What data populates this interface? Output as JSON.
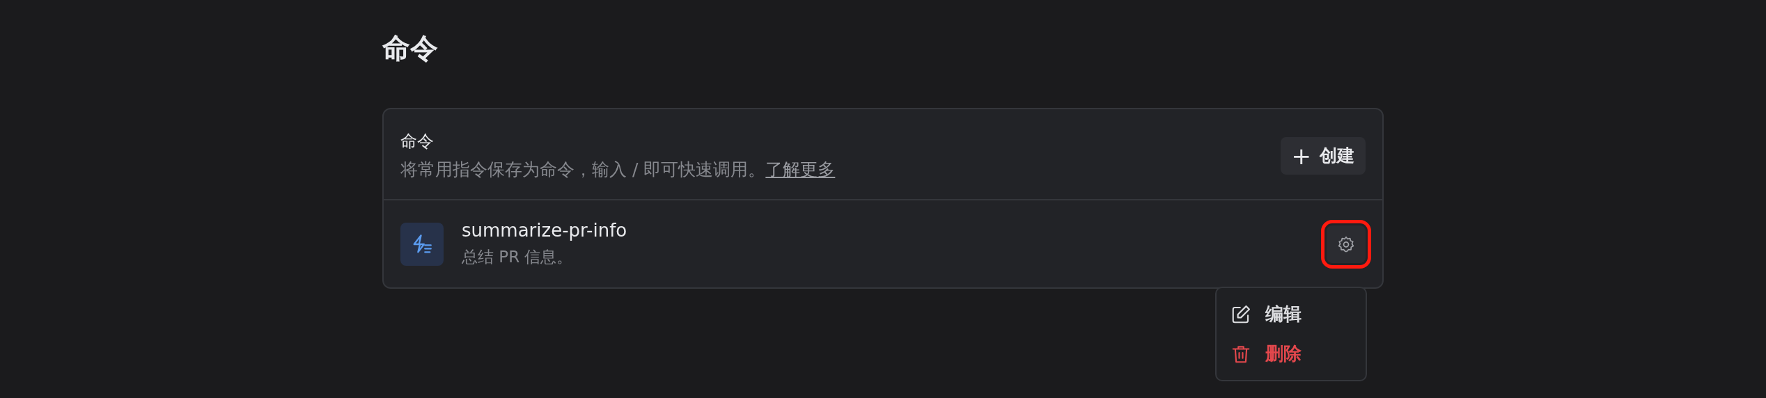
{
  "page_title": "命令",
  "section": {
    "title": "命令",
    "description": "将常用指令保存为命令，输入 / 即可快速调用。",
    "link": "了解更多",
    "create_button": {
      "icon": "+",
      "label": "创建"
    }
  },
  "commands": [
    {
      "name": "summarize-pr-info",
      "description": "总结 PR 信息。",
      "settings_highlighted": true,
      "menu_open": true
    }
  ],
  "menu": [
    {
      "kind": "edit",
      "label": "编辑"
    },
    {
      "kind": "delete",
      "label": "删除"
    }
  ]
}
